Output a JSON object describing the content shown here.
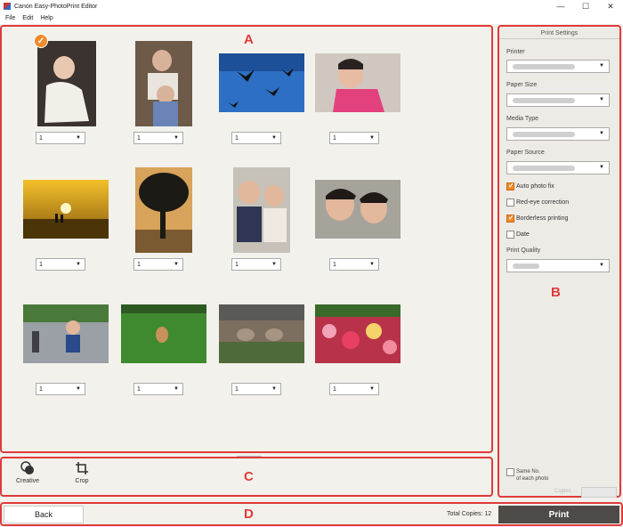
{
  "window": {
    "title": "Canon Easy-PhotoPrint Editor",
    "minimize": "—",
    "maximize": "☐",
    "close": "✕"
  },
  "menu": [
    "File",
    "Edit",
    "Help"
  ],
  "markers": {
    "a": "A",
    "b": "B",
    "c": "C",
    "d": "D"
  },
  "photos": [
    {
      "copies": "1",
      "selected": true
    },
    {
      "copies": "1"
    },
    {
      "copies": "1"
    },
    {
      "copies": "1"
    },
    {
      "copies": "1"
    },
    {
      "copies": "1"
    },
    {
      "copies": "1"
    },
    {
      "copies": "1"
    },
    {
      "copies": "1"
    },
    {
      "copies": "1"
    },
    {
      "copies": "1"
    },
    {
      "copies": "1"
    }
  ],
  "settings": {
    "title": "Print Settings",
    "printer_label": "Printer",
    "paper_size_label": "Paper Size",
    "media_type_label": "Media Type",
    "paper_source_label": "Paper Source",
    "auto_photo_fix": "Auto photo fix",
    "red_eye": "Red-eye correction",
    "borderless": "Borderless printing",
    "date": "Date",
    "print_quality_label": "Print Quality",
    "same_no_line1": "Same No.",
    "same_no_line2": "of each photo",
    "copies_label": "Copies"
  },
  "checks": {
    "auto_photo_fix": true,
    "red_eye": false,
    "borderless": true,
    "date": false,
    "same_no": false
  },
  "tools": {
    "creative": "Creative",
    "crop": "Crop"
  },
  "bottom": {
    "back": "Back",
    "total_copies": "Total Copies: 12",
    "print": "Print"
  },
  "colors": {
    "highlight": "#e03a3a",
    "accent": "#f08a2a",
    "print_button": "#4d4a47"
  }
}
